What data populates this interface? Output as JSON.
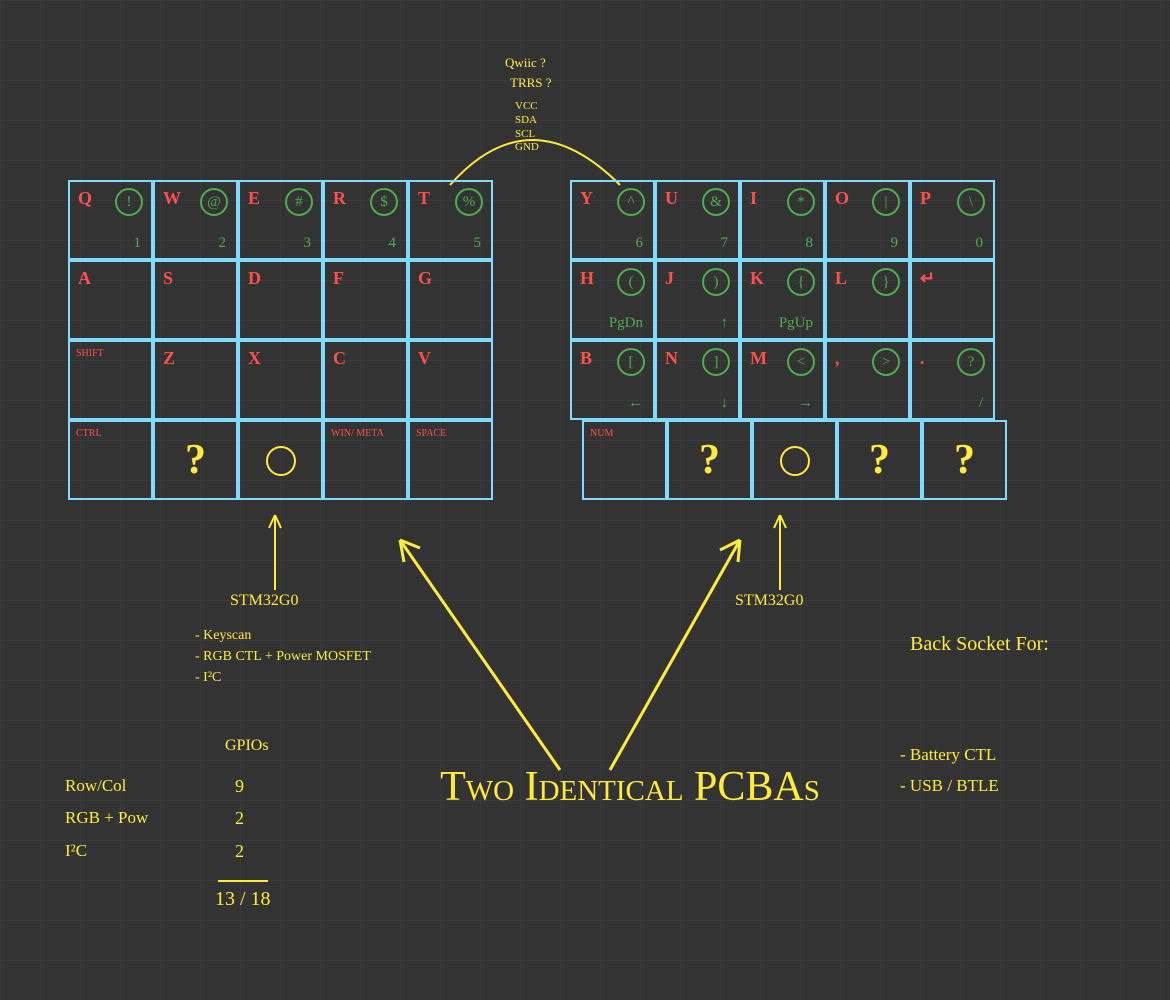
{
  "main_label": "Two Identical PCBAs",
  "link": {
    "q1": "Qwiic ?",
    "q2": "TRRS ?",
    "pins": [
      "VCC",
      "SDA",
      "SCL",
      "GND"
    ]
  },
  "mcu": {
    "name": "STM32G0",
    "tasks": [
      "- Keyscan",
      "- RGB CTL + Power MOSFET",
      "- I²C"
    ]
  },
  "gpios": {
    "title": "GPIOs",
    "rows": [
      {
        "label": "Row/Col",
        "n": "9"
      },
      {
        "label": "RGB + Pow",
        "n": "2"
      },
      {
        "label": "I²C",
        "n": "2"
      }
    ],
    "total": "13 / 18"
  },
  "back": {
    "title": "Back Socket For:",
    "items": [
      "- Battery CTL",
      "- USB / BTLE"
    ]
  },
  "left": [
    [
      {
        "p": "Q",
        "s": "!",
        "sub": "1"
      },
      {
        "p": "W",
        "s": "@",
        "sub": "2"
      },
      {
        "p": "E",
        "s": "#",
        "sub": "3"
      },
      {
        "p": "R",
        "s": "$",
        "sub": "4"
      },
      {
        "p": "T",
        "s": "%",
        "sub": "5"
      }
    ],
    [
      {
        "p": "A"
      },
      {
        "p": "S"
      },
      {
        "p": "D"
      },
      {
        "p": "F"
      },
      {
        "p": "G"
      }
    ],
    [
      {
        "corner": "shift"
      },
      {
        "p": "Z"
      },
      {
        "p": "X"
      },
      {
        "p": "C"
      },
      {
        "p": "V"
      }
    ],
    [
      {
        "corner": "ctrl"
      },
      {
        "q": "?"
      },
      {
        "yc": true
      },
      {
        "corner": "win/ meta"
      },
      {
        "corner": "space"
      }
    ]
  ],
  "right": [
    [
      {
        "p": "Y",
        "s": "^",
        "sub": "6"
      },
      {
        "p": "U",
        "s": "&",
        "sub": "7"
      },
      {
        "p": "I",
        "s": "*",
        "sub": "8"
      },
      {
        "p": "O",
        "s": "|",
        "sub": "9"
      },
      {
        "p": "P",
        "s": "\\",
        "sub": "0"
      }
    ],
    [
      {
        "p": "H",
        "s": "(",
        "sub": "PgDn"
      },
      {
        "p": "J",
        "s": ")",
        "sub": "↑"
      },
      {
        "p": "K",
        "s": "{",
        "sub": "PgUp"
      },
      {
        "p": "L",
        "s": "}"
      },
      {
        "p": "↵"
      }
    ],
    [
      {
        "p": "B",
        "s": "[",
        "sub": "←"
      },
      {
        "p": "N",
        "s": "]",
        "sub": "↓"
      },
      {
        "p": "M",
        "s": "<",
        "sub": "→"
      },
      {
        "p": ",",
        "s": ">"
      },
      {
        "p": ".",
        "s": "?",
        "sub": "/"
      }
    ],
    [
      {
        "corner": "num"
      },
      {
        "q": "?"
      },
      {
        "yc": true
      },
      {
        "q": "?"
      },
      {
        "q": "?"
      }
    ]
  ]
}
